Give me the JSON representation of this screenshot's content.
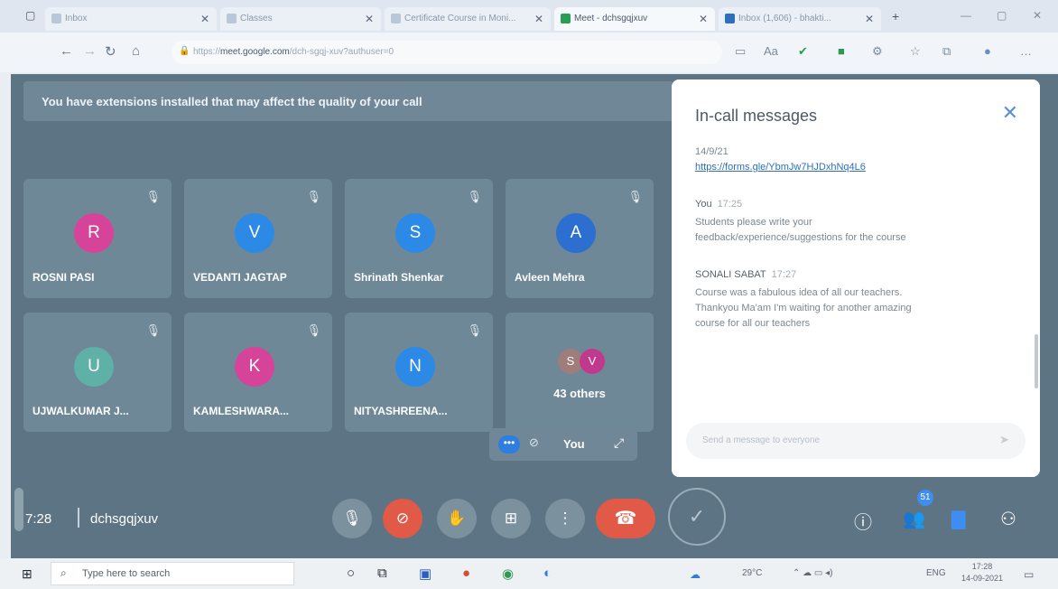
{
  "browser": {
    "tabs": [
      {
        "title": "Inbox",
        "active": false
      },
      {
        "title": "Classes",
        "active": false
      },
      {
        "title": "Certificate Course in Moni...",
        "active": false
      },
      {
        "title": "Meet - dchsgqjxuv",
        "active": true
      },
      {
        "title": "Inbox (1,606) - bhakti...",
        "active": false
      }
    ],
    "url_host": "meet.google.com",
    "url_path": "/dch-sgqj-xuv?authuser=0"
  },
  "banner_text": "You have extensions installed that may affect the quality of your call",
  "participants": [
    {
      "initial": "R",
      "name": "ROSNI PASI",
      "color": "#d6449a"
    },
    {
      "initial": "V",
      "name": "VEDANTI JAGTAP",
      "color": "#2c8ae6"
    },
    {
      "initial": "S",
      "name": "Shrinath Shenkar",
      "color": "#2c8ae6"
    },
    {
      "initial": "A",
      "name": "Avleen Mehra",
      "color": "#2c6fd0"
    },
    {
      "initial": "U",
      "name": "UJWALKUMAR J...",
      "color": "#5fb0a6"
    },
    {
      "initial": "K",
      "name": "KAMLESHWARA...",
      "color": "#d6449a"
    },
    {
      "initial": "N",
      "name": "NITYASHREENA...",
      "color": "#2c8ae6"
    }
  ],
  "others": {
    "a1": "S",
    "a2": "V",
    "label": "43 others"
  },
  "self_view": {
    "label": "You",
    "more": "•••"
  },
  "chat": {
    "title": "In-call messages",
    "messages": [
      {
        "sender": "",
        "time": "",
        "lines": [
          "14/9/21"
        ],
        "link": "https://forms.gle/YbmJw7HJDxhNq4L6"
      },
      {
        "sender": "You",
        "time": "17:25",
        "lines": [
          "Students please write your",
          "feedback/experience/suggestions for the course"
        ],
        "link": ""
      },
      {
        "sender": "SONALI SABAT",
        "time": "17:27",
        "lines": [
          "Course was a fabulous idea of all our teachers.",
          "Thankyou Ma'am I'm waiting for another amazing",
          "course for all our teachers"
        ],
        "link": ""
      }
    ],
    "input_placeholder": "Send a message to everyone"
  },
  "meeting": {
    "time": "7:28",
    "code": "dchsgqjxuv"
  },
  "people_badge": "51",
  "taskbar": {
    "search_placeholder": "Type here to search",
    "weather": "29°C",
    "lang": "ENG",
    "clock_time": "17:28",
    "clock_date": "14-09-2021"
  }
}
